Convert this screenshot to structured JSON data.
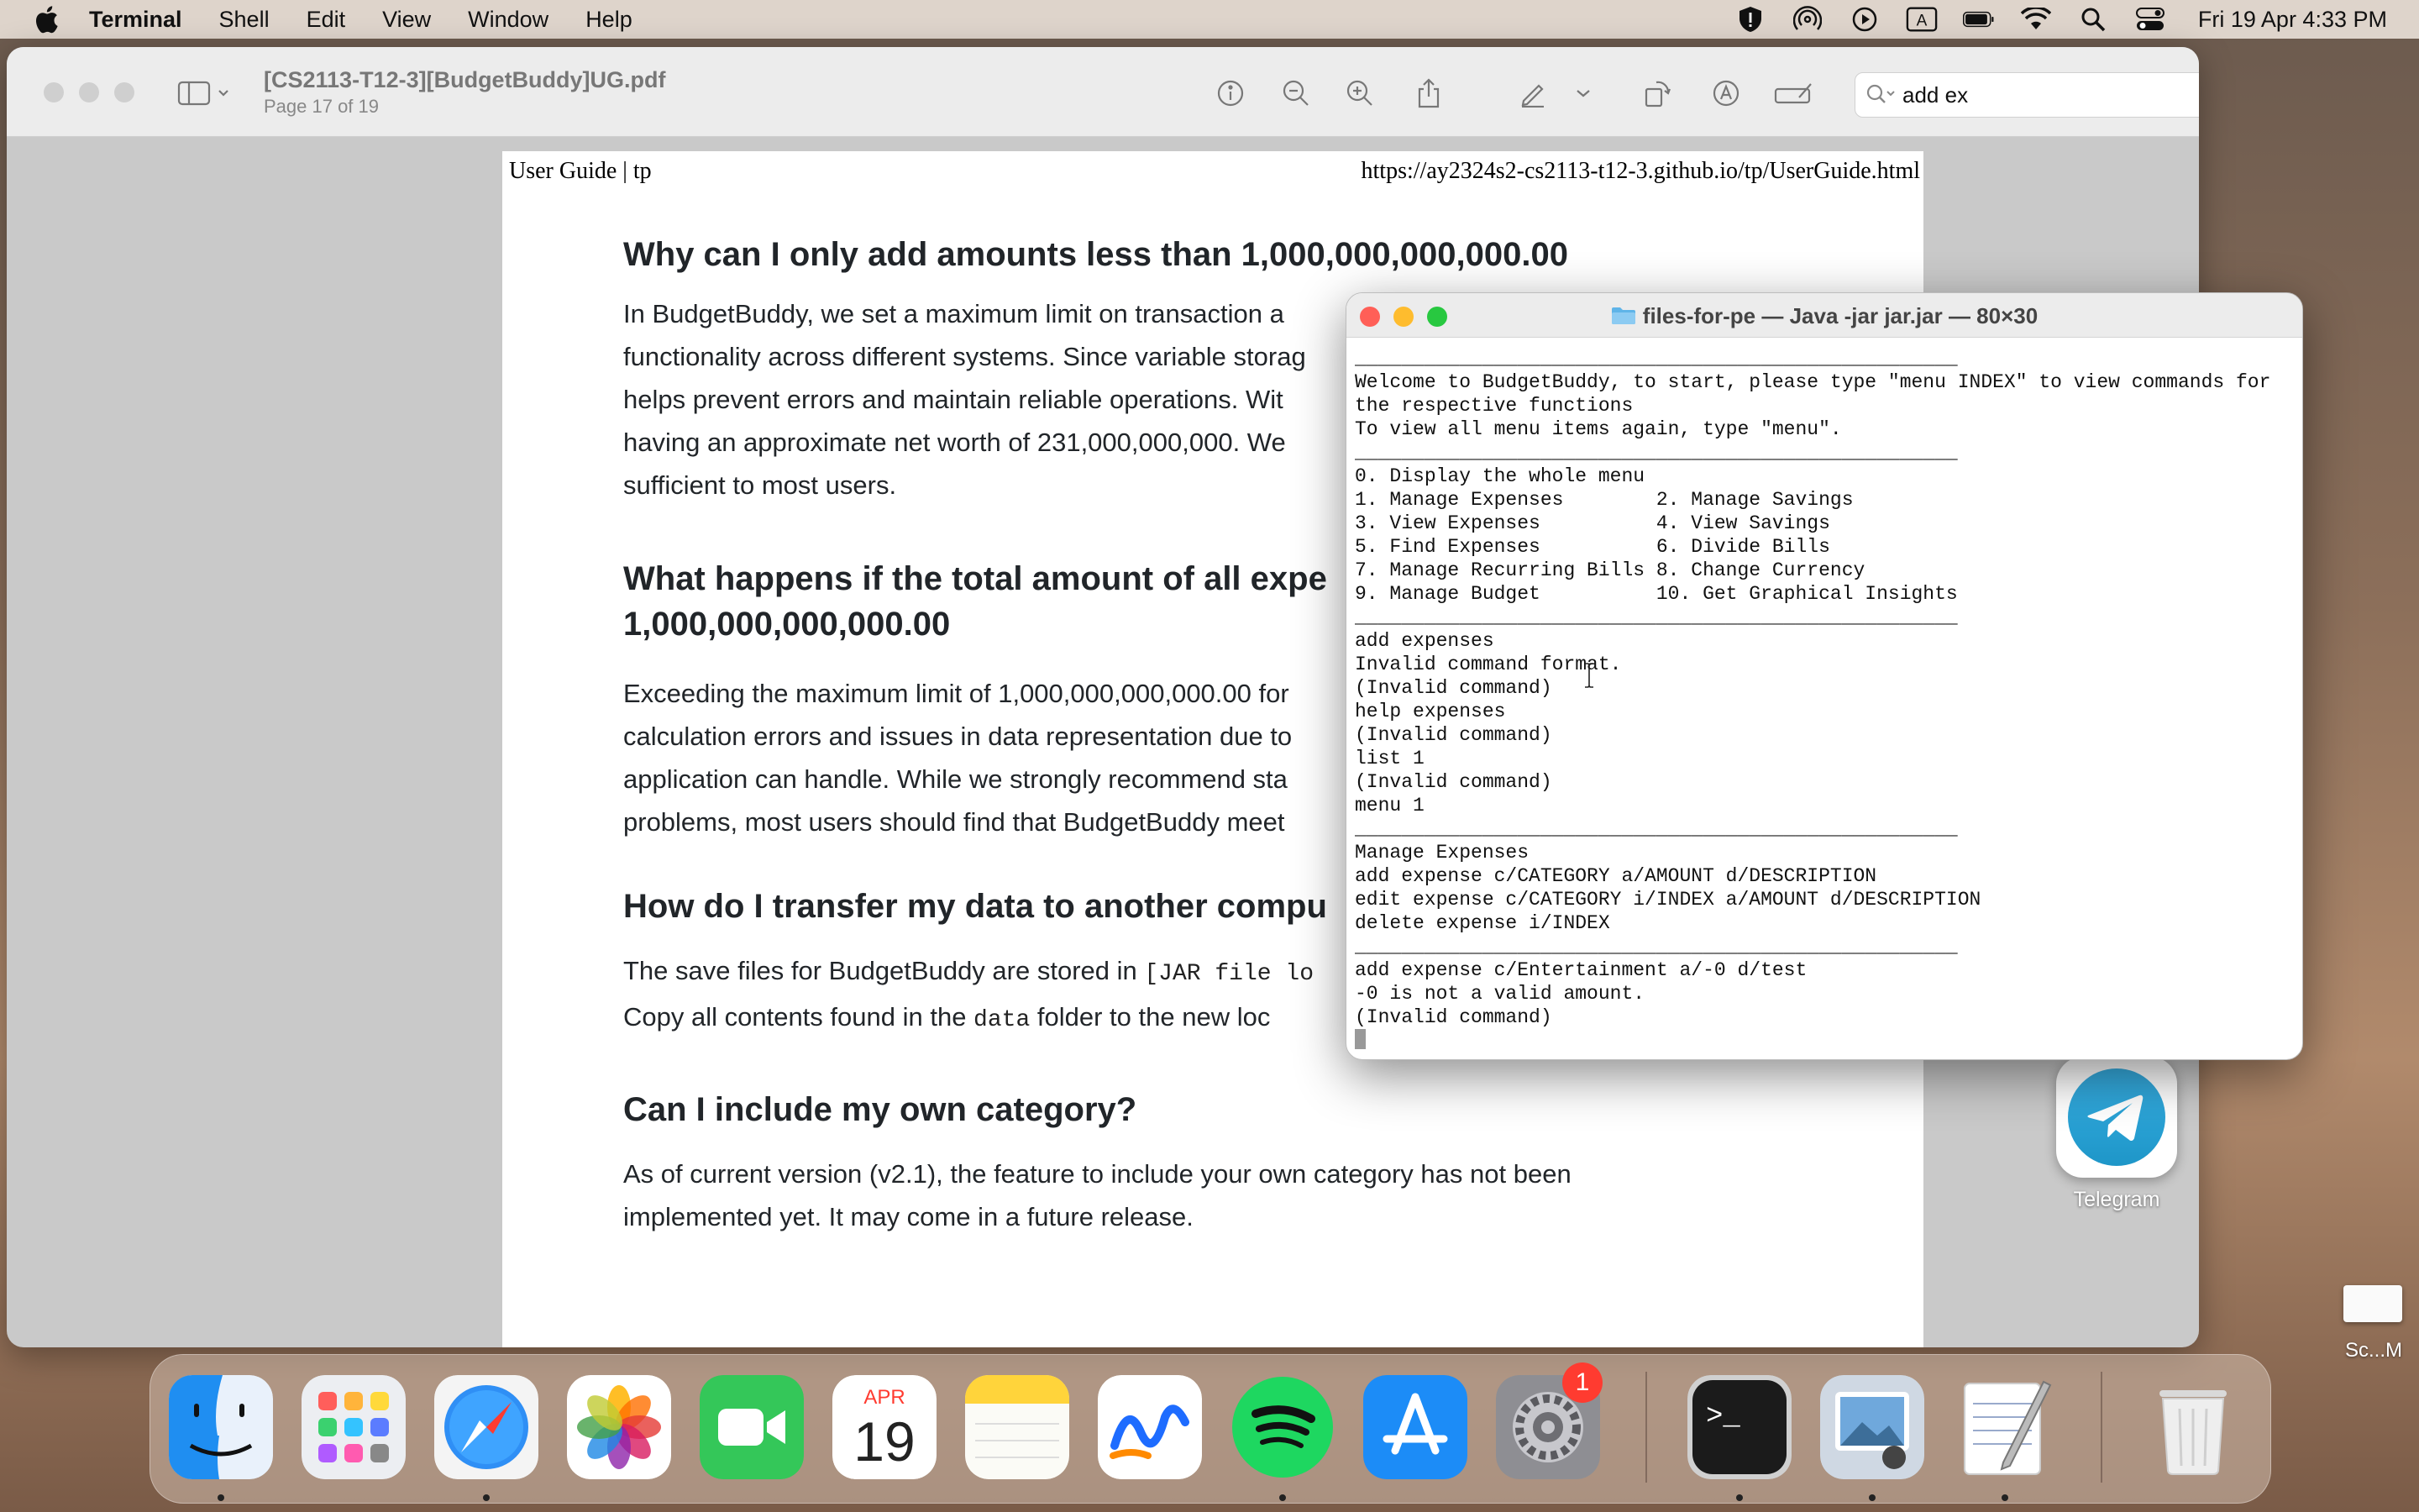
{
  "menubar": {
    "app_name": "Terminal",
    "items": [
      "Shell",
      "Edit",
      "View",
      "Window",
      "Help"
    ],
    "status_icons": [
      "shield-icon",
      "airdrop-icon",
      "play-icon",
      "input-source-icon",
      "battery-icon",
      "wifi-icon",
      "search-icon",
      "control-center-icon"
    ],
    "input_source_letter": "A",
    "clock": "Fri 19 Apr  4:33 PM"
  },
  "preview": {
    "title": "[CS2113-T12-3][BudgetBuddy]UG.pdf",
    "subtitle": "Page 17 of 19",
    "search_value": "add ex"
  },
  "pdf": {
    "header_left": "User Guide | tp",
    "header_right": "https://ay2324s2-cs2113-t12-3.github.io/tp/UserGuide.html",
    "sections": [
      {
        "heading": "Why can I only add amounts less than 1,000,000,000,000.00",
        "lines": [
          "In BudgetBuddy, we set a maximum limit on transaction a",
          "functionality across different systems. Since variable storag",
          "helps prevent errors and maintain reliable operations. Wit",
          "having an approximate net worth of 231,000,000,000. We",
          "sufficient to most users."
        ]
      },
      {
        "heading_lines": [
          "What happens if the total amount of all expe",
          "1,000,000,000,000.00"
        ],
        "lines": [
          "Exceeding the maximum limit of 1,000,000,000,000.00 for",
          "calculation errors and issues in data representation due to",
          "application can handle. While we strongly recommend sta",
          "problems, most users should find that BudgetBuddy meet"
        ]
      },
      {
        "heading": "How do I transfer my data to another compu",
        "line1_pre": "The save files for BudgetBuddy are stored in ",
        "line1_code": "[JAR file lo",
        "line2_pre": "Copy all contents found in the ",
        "line2_code": "data",
        "line2_post": " folder to the new loc"
      },
      {
        "heading": "Can I include my own category?",
        "lines": [
          "As of current version (v2.1), the feature to include your own category has not been",
          "implemented yet. It may come in a future release."
        ]
      }
    ]
  },
  "terminal": {
    "title": "files-for-pe — Java -jar jar.jar — 80×30",
    "lines": [
      "____________________________________________________",
      "Welcome to BudgetBuddy, to start, please type \"menu INDEX\" to view commands for",
      "the respective functions",
      "To view all menu items again, type \"menu\".",
      "____________________________________________________",
      "0. Display the whole menu",
      "1. Manage Expenses        2. Manage Savings",
      "3. View Expenses          4. View Savings",
      "5. Find Expenses          6. Divide Bills",
      "7. Manage Recurring Bills 8. Change Currency",
      "9. Manage Budget          10. Get Graphical Insights",
      "____________________________________________________",
      "add expenses",
      "Invalid command format.",
      "(Invalid command)",
      "help expenses",
      "(Invalid command)",
      "list 1",
      "(Invalid command)",
      "menu 1",
      "____________________________________________________",
      "Manage Expenses",
      "add expense c/CATEGORY a/AMOUNT d/DESCRIPTION",
      "edit expense c/CATEGORY i/INDEX a/AMOUNT d/DESCRIPTION",
      "delete expense i/INDEX",
      "____________________________________________________",
      "add expense c/Entertainment a/-0 d/test",
      "-0 is not a valid amount.",
      "(Invalid command)"
    ]
  },
  "desktop": {
    "telegram_label": "Telegram",
    "screenshot_label": "Sc...M"
  },
  "dock": {
    "apps": [
      "Finder",
      "Launchpad",
      "Safari",
      "Photos",
      "FaceTime",
      "Calendar",
      "Notes",
      "Freeform",
      "Spotify",
      "App Store",
      "System Settings",
      "Terminal",
      "Preview",
      "TextEdit",
      "Trash"
    ],
    "calendar_month": "APR",
    "calendar_day": "19",
    "settings_badge": "1",
    "terminal_prompt": ">_"
  }
}
